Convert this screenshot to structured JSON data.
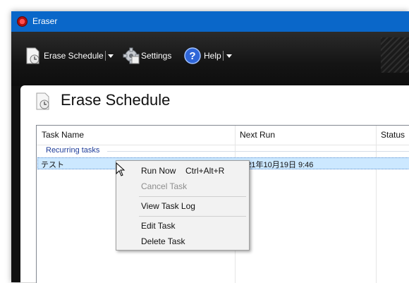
{
  "window": {
    "title": "Eraser"
  },
  "toolbar": {
    "erase_schedule_label": "Erase Schedule",
    "settings_label": "Settings",
    "help_label": "Help"
  },
  "page": {
    "title": "Erase Schedule"
  },
  "list": {
    "columns": [
      "Task Name",
      "Next Run",
      "Status"
    ],
    "group": "Recurring tasks",
    "rows": [
      {
        "task_name": "テスト",
        "next_run": "2021年10月19日 9:46",
        "status": ""
      }
    ]
  },
  "context_menu": {
    "items": [
      {
        "label": "Run Now",
        "shortcut": "Ctrl+Alt+R",
        "enabled": true
      },
      {
        "label": "Cancel Task",
        "enabled": false
      },
      {
        "label": "View Task Log",
        "enabled": true
      },
      {
        "label": "Edit Task",
        "enabled": true
      },
      {
        "label": "Delete Task",
        "enabled": true
      }
    ]
  },
  "icons": {
    "app": "eraser-app-icon",
    "schedule": "schedule-clock-icon",
    "settings": "gear-icon",
    "help": "help-icon"
  },
  "colors": {
    "titlebar": "#0a67c9",
    "toolbar": "#141414",
    "selection": "#cce8ff",
    "group_text": "#1f3d99"
  }
}
